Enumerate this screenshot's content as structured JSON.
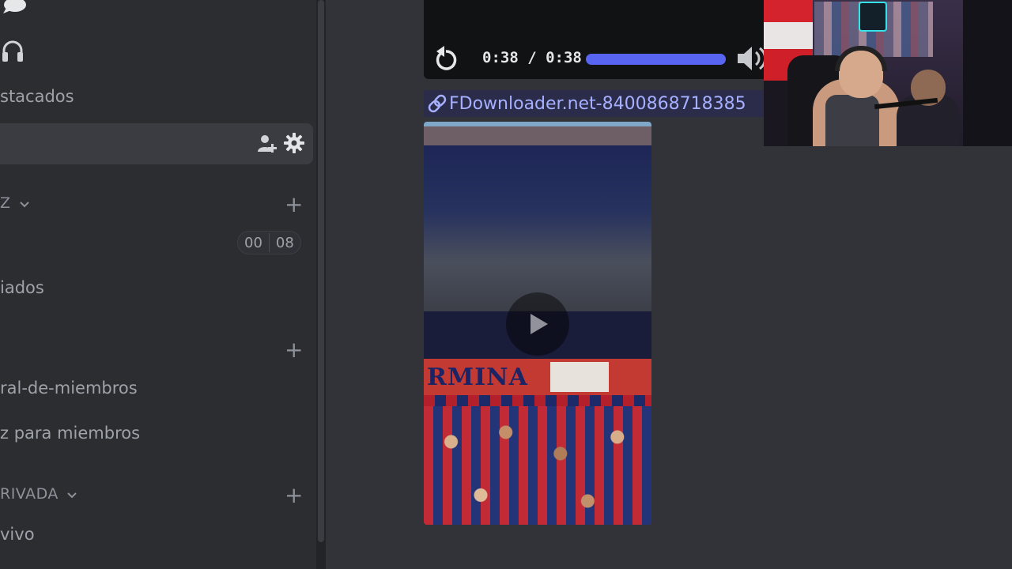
{
  "sidebar": {
    "items": [
      {
        "label": "stacados"
      },
      {
        "label": "iados"
      },
      {
        "label": "ral-de-miembros"
      },
      {
        "label": "z para miembros"
      },
      {
        "label": "vivo"
      }
    ],
    "categories": [
      {
        "label": "Z"
      },
      {
        "label": "RIVADA"
      }
    ],
    "counter": {
      "left": "00",
      "right": "08"
    }
  },
  "player": {
    "time": "0:38 / 0:38",
    "progress": 1.0
  },
  "attachment": {
    "filename": "FDownloader.net-8400868718385"
  },
  "video": {
    "banner_text": "RMINA"
  },
  "colors": {
    "sidebar_bg": "#2b2d31",
    "main_bg": "#313338",
    "accent": "#5865f2",
    "link": "#a7b0ff"
  }
}
